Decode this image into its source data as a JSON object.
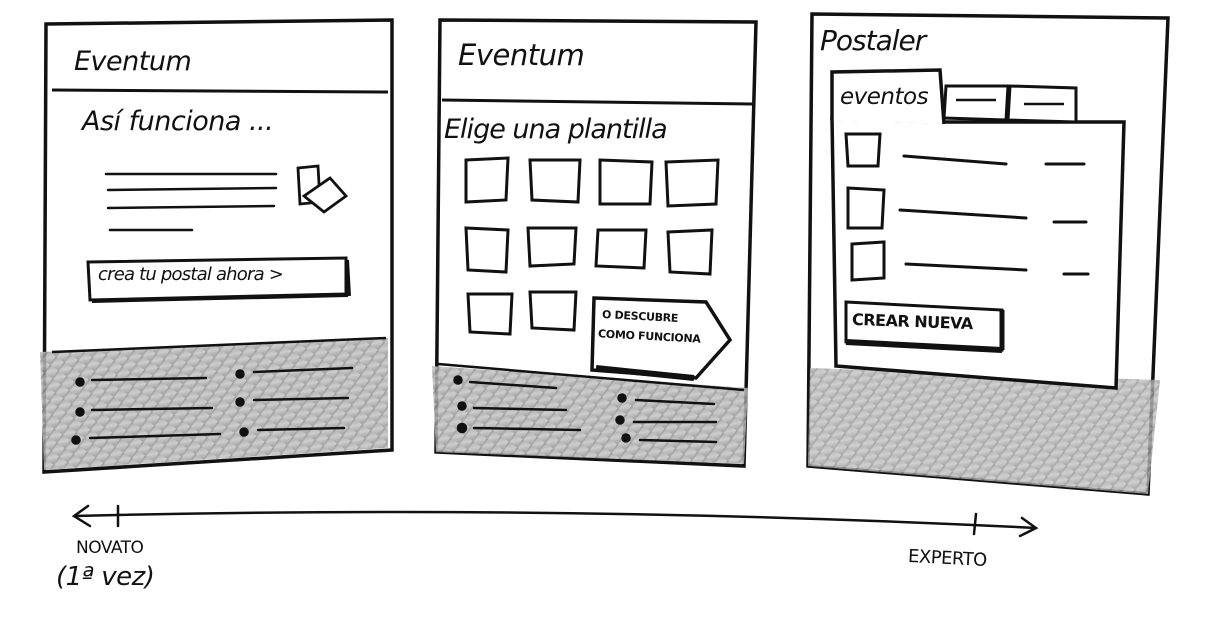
{
  "panels": [
    {
      "brand": "Eventum",
      "heading": "Así funciona ...",
      "cta": "crea tu postal ahora >"
    },
    {
      "brand": "Eventum",
      "heading": "Elige una plantilla",
      "callout_line1": "O DESCUBRE",
      "callout_line2": "COMO FUNCIONA"
    },
    {
      "brand": "Postaler",
      "tab_active": "eventos",
      "tab_2": "—",
      "tab_3": "—",
      "button": "CREAR NUEVA"
    }
  ],
  "axis": {
    "left_label_line1": "NOVATO",
    "left_label_line2": "(1ª vez)",
    "right_label": "EXPERTO"
  }
}
